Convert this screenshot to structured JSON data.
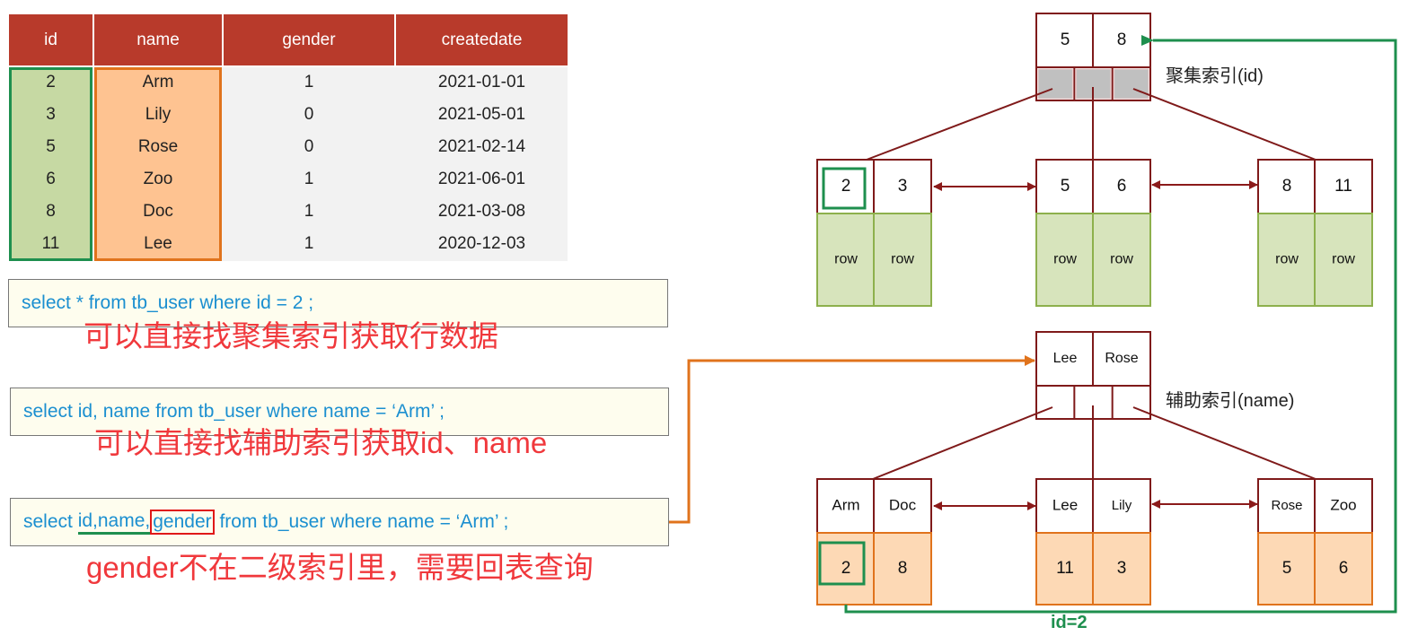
{
  "table": {
    "headers": [
      "id",
      "name",
      "gender",
      "createdate"
    ],
    "rows": [
      [
        "2",
        "Arm",
        "1",
        "2021-01-01"
      ],
      [
        "3",
        "Lily",
        "0",
        "2021-05-01"
      ],
      [
        "5",
        "Rose",
        "0",
        "2021-02-14"
      ],
      [
        "6",
        "Zoo",
        "1",
        "2021-06-01"
      ],
      [
        "8",
        "Doc",
        "1",
        "2021-03-08"
      ],
      [
        "11",
        "Lee",
        "1",
        "2020-12-03"
      ]
    ]
  },
  "queries": [
    {
      "sql": "select * from tb_user where id = 2 ;",
      "note": "可以直接找聚集索引获取行数据"
    },
    {
      "sql": "select id, name from tb_user where name = ‘Arm’ ;",
      "note": "可以直接找辅助索引获取id、name"
    },
    {
      "sql_prefix": "select ",
      "sql_underlined": "id,name,",
      "sql_highlight": "gender",
      "sql_suffix": " from tb_user where name = ‘Arm’ ;",
      "note": "gender不在二级索引里，需要回表查询"
    }
  ],
  "clustered_index": {
    "label": "聚集索引(id)",
    "root_keys": [
      "5",
      "8"
    ],
    "leaves": [
      {
        "keys": [
          "2",
          "3"
        ],
        "values": [
          "row",
          "row"
        ]
      },
      {
        "keys": [
          "5",
          "6"
        ],
        "values": [
          "row",
          "row"
        ]
      },
      {
        "keys": [
          "8",
          "11"
        ],
        "values": [
          "row",
          "row"
        ]
      }
    ]
  },
  "secondary_index": {
    "label": "辅助索引(name)",
    "root_keys": [
      "Lee",
      "Rose"
    ],
    "leaves": [
      {
        "keys": [
          "Arm",
          "Doc"
        ],
        "values": [
          "2",
          "8"
        ]
      },
      {
        "keys": [
          "Lee",
          "Lily"
        ],
        "values": [
          "11",
          "3"
        ]
      },
      {
        "keys": [
          "Rose",
          "Zoo"
        ],
        "values": [
          "5",
          "6"
        ]
      }
    ]
  },
  "lookup_label": "id=2",
  "colors": {
    "header": "#b83a2b",
    "id_column": "#c6d9a3",
    "name_column": "#fec391",
    "node_border": "#7f1a1a",
    "leaf_green": "#d7e4bc",
    "leaf_orange": "#fdd9b5",
    "highlight_green": "#1e8f4e",
    "arrow_orange": "#e0731c",
    "note_red": "#f0383c",
    "sql_blue": "#1b8fd0"
  }
}
